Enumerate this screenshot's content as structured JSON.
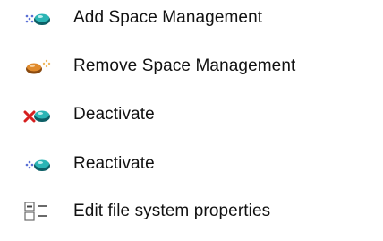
{
  "menu": {
    "items": [
      {
        "label": "Add Space Management",
        "icon": "add-space-management-icon"
      },
      {
        "label": "Remove Space Management",
        "icon": "remove-space-management-icon"
      },
      {
        "label": "Deactivate",
        "icon": "deactivate-icon"
      },
      {
        "label": "Reactivate",
        "icon": "reactivate-icon"
      },
      {
        "label": "Edit file system properties",
        "icon": "edit-properties-icon"
      }
    ]
  },
  "colors": {
    "teal": "#1a8f8f",
    "teal_dark": "#0d5f66",
    "blue_dots": "#5a6fd6",
    "orange": "#e08a2c",
    "red": "#d62020",
    "gray_icon": "#7a7a7a"
  }
}
